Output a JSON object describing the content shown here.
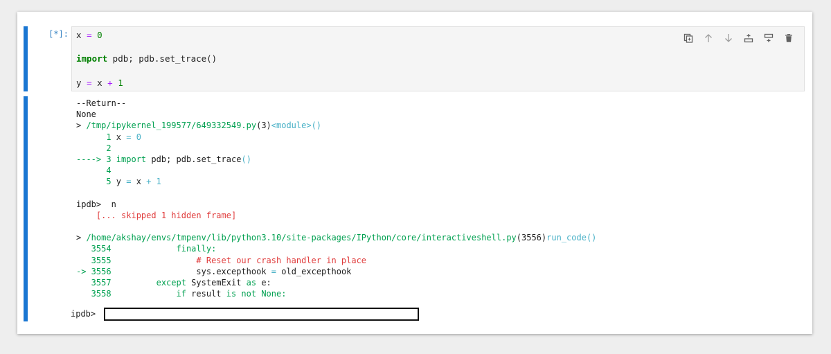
{
  "cell": {
    "prompt": "[*]:",
    "code_lines": [
      [
        {
          "t": "x",
          "c": ""
        },
        {
          "t": " ",
          "c": ""
        },
        {
          "t": "=",
          "c": "op"
        },
        {
          "t": " ",
          "c": ""
        },
        {
          "t": "0",
          "c": "num"
        }
      ],
      [
        {
          "t": "import",
          "c": "kw"
        },
        {
          "t": " pdb; pdb.",
          "c": ""
        },
        {
          "t": "set_trace",
          "c": ""
        },
        {
          "t": "()",
          "c": ""
        }
      ],
      [
        {
          "t": "y",
          "c": ""
        },
        {
          "t": " ",
          "c": ""
        },
        {
          "t": "=",
          "c": "op"
        },
        {
          "t": " x ",
          "c": ""
        },
        {
          "t": "+",
          "c": "op"
        },
        {
          "t": " ",
          "c": ""
        },
        {
          "t": "1",
          "c": "num"
        }
      ]
    ]
  },
  "toolbar": {
    "buttons": [
      {
        "name": "duplicate-cell-button",
        "icon": "duplicate-icon"
      },
      {
        "name": "move-up-button",
        "icon": "arrow-up-icon"
      },
      {
        "name": "move-down-button",
        "icon": "arrow-down-icon"
      },
      {
        "name": "insert-above-button",
        "icon": "insert-above-icon"
      },
      {
        "name": "insert-below-button",
        "icon": "insert-below-icon"
      },
      {
        "name": "delete-cell-button",
        "icon": "trash-icon"
      }
    ]
  },
  "output": {
    "lines": [
      [
        {
          "t": "--Return--",
          "c": ""
        }
      ],
      [
        {
          "t": "None",
          "c": ""
        }
      ],
      [
        {
          "t": "> ",
          "c": ""
        },
        {
          "t": "/tmp/ipykernel_199577/649332549.py",
          "c": "g"
        },
        {
          "t": "(3)",
          "c": ""
        },
        {
          "t": "<module>",
          "c": "c"
        },
        {
          "t": "()",
          "c": "c"
        }
      ],
      [
        {
          "t": "      1 ",
          "c": "g"
        },
        {
          "t": "x ",
          "c": ""
        },
        {
          "t": "=",
          "c": "c"
        },
        {
          "t": " ",
          "c": ""
        },
        {
          "t": "0",
          "c": "c"
        }
      ],
      [
        {
          "t": "      2",
          "c": "g"
        }
      ],
      [
        {
          "t": "----> 3 ",
          "c": "g"
        },
        {
          "t": "import",
          "c": "g"
        },
        {
          "t": " pdb",
          "c": ""
        },
        {
          "t": ";",
          "c": ""
        },
        {
          "t": " pdb",
          "c": ""
        },
        {
          "t": ".",
          "c": ""
        },
        {
          "t": "set_trace",
          "c": ""
        },
        {
          "t": "()",
          "c": "c"
        }
      ],
      [
        {
          "t": "      4",
          "c": "g"
        }
      ],
      [
        {
          "t": "      5 ",
          "c": "g"
        },
        {
          "t": "y ",
          "c": ""
        },
        {
          "t": "=",
          "c": "c"
        },
        {
          "t": " x ",
          "c": ""
        },
        {
          "t": "+",
          "c": "c"
        },
        {
          "t": " ",
          "c": ""
        },
        {
          "t": "1",
          "c": "c"
        }
      ],
      [
        {
          "t": "",
          "c": ""
        }
      ],
      [
        {
          "t": "ipdb>  n",
          "c": ""
        }
      ],
      [
        {
          "t": "    [... skipped 1 hidden frame]",
          "c": "r"
        }
      ],
      [
        {
          "t": "",
          "c": ""
        }
      ],
      [
        {
          "t": "> ",
          "c": ""
        },
        {
          "t": "/home/akshay/envs/tmpenv/lib/python3.10/site-packages/IPython/core/interactiveshell.py",
          "c": "g"
        },
        {
          "t": "(3556)",
          "c": ""
        },
        {
          "t": "run_code",
          "c": "c"
        },
        {
          "t": "()",
          "c": "c"
        }
      ],
      [
        {
          "t": "   3554             ",
          "c": "g"
        },
        {
          "t": "finally:",
          "c": "g"
        }
      ],
      [
        {
          "t": "   3555                 ",
          "c": "g"
        },
        {
          "t": "# Reset our crash handler in place",
          "c": "r"
        }
      ],
      [
        {
          "t": "-> 3556                 ",
          "c": "g"
        },
        {
          "t": "sys",
          "c": ""
        },
        {
          "t": ".",
          "c": ""
        },
        {
          "t": "excepthook ",
          "c": ""
        },
        {
          "t": "=",
          "c": "c"
        },
        {
          "t": " old_excepthook",
          "c": ""
        }
      ],
      [
        {
          "t": "   3557         ",
          "c": "g"
        },
        {
          "t": "except",
          "c": "g"
        },
        {
          "t": " SystemExit ",
          "c": ""
        },
        {
          "t": "as",
          "c": "g"
        },
        {
          "t": " e:",
          "c": ""
        }
      ],
      [
        {
          "t": "   3558             ",
          "c": "g"
        },
        {
          "t": "if",
          "c": "g"
        },
        {
          "t": " result ",
          "c": ""
        },
        {
          "t": "is not",
          "c": "g"
        },
        {
          "t": " None:",
          "c": "g"
        }
      ]
    ]
  },
  "ipdb": {
    "label": "ipdb>",
    "value": ""
  }
}
